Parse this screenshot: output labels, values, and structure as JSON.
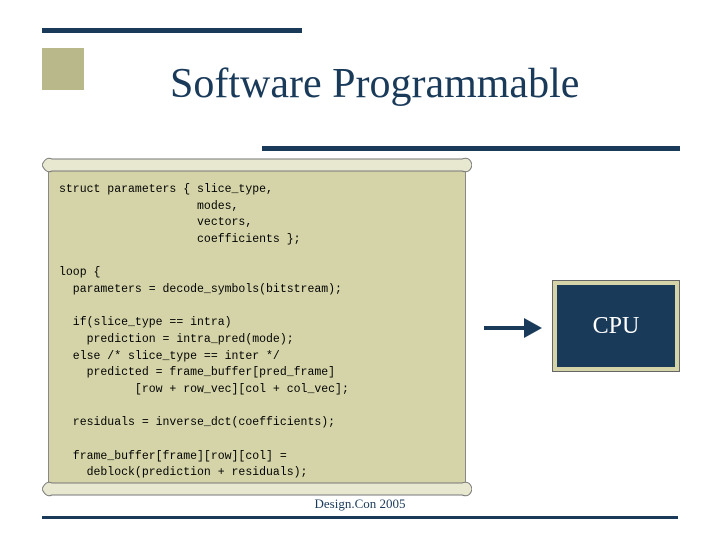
{
  "title": "Software Programmable",
  "code": "struct parameters { slice_type,\n                    modes,\n                    vectors,\n                    coefficients };\n\nloop {\n  parameters = decode_symbols(bitstream);\n\n  if(slice_type == intra)\n    prediction = intra_pred(mode);\n  else /* slice_type == inter */\n    predicted = frame_buffer[pred_frame]\n           [row + row_vec][col + col_vec];\n\n  residuals = inverse_dct(coefficients);\n\n  frame_buffer[frame][row][col] =\n    deblock(prediction + residuals);\n}",
  "cpu_label": "CPU",
  "footer": "Design.Con 2005"
}
